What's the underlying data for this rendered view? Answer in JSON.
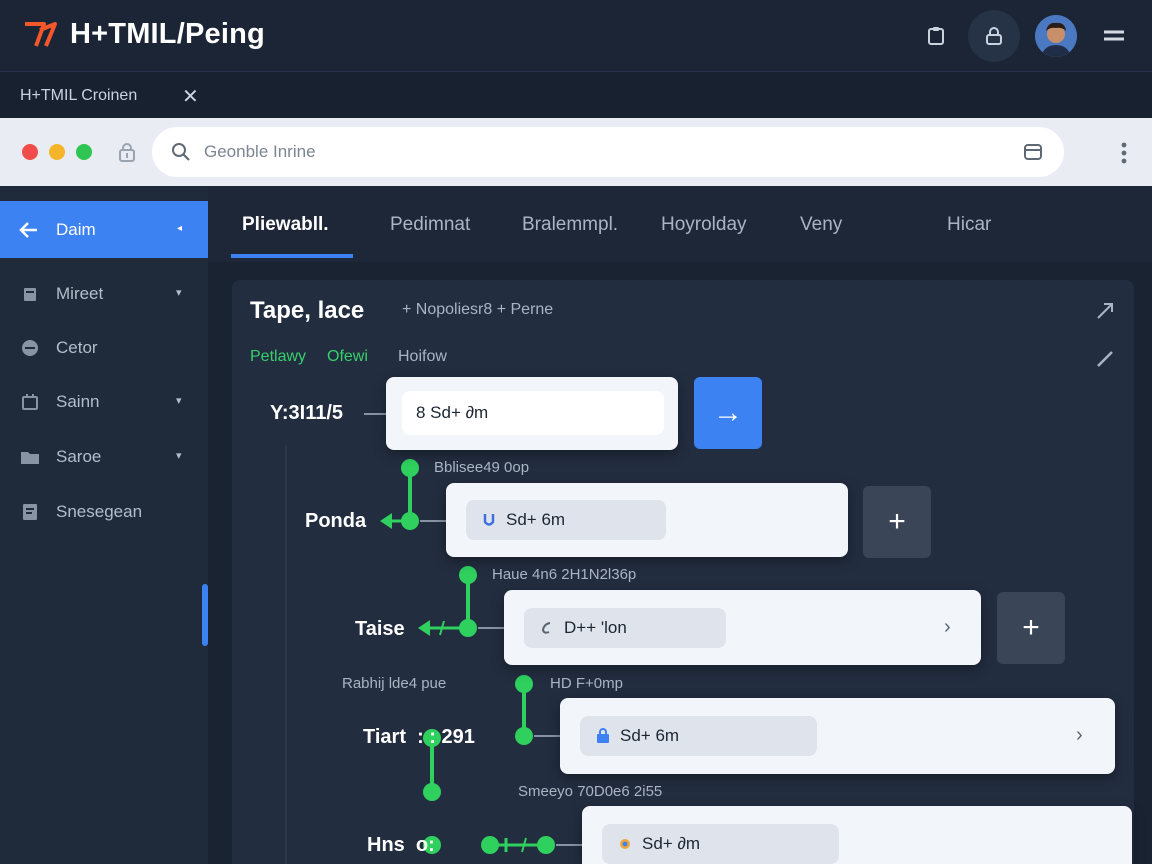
{
  "app": {
    "title": "H+TMIL/Peing"
  },
  "window_tab": {
    "label": "H+TMIL Croinen",
    "close": "✕"
  },
  "address_bar": {
    "placeholder": "Geonble Inrine"
  },
  "sidebar": {
    "items": [
      {
        "label": "Daim",
        "icon": "arrow-left-icon",
        "active": true
      },
      {
        "label": "Mireet",
        "icon": "folder-icon"
      },
      {
        "label": "Cetor",
        "icon": "settings-icon"
      },
      {
        "label": "Sainn",
        "icon": "calendar-icon"
      },
      {
        "label": "Saroe",
        "icon": "folder-icon"
      },
      {
        "label": "Snesegean",
        "icon": "document-icon"
      }
    ]
  },
  "nav_tabs": [
    "Pliewabll.",
    "Pedimnat",
    "Bralemmpl.",
    "Hoyrolday",
    "Veny",
    "Hicar"
  ],
  "panel": {
    "title": "Tape, lace",
    "add_label": "+  Nopoliesr8 + Perne",
    "filters": [
      "Petlawy",
      "Ofewi",
      "Hoifow"
    ]
  },
  "flow": {
    "nodes": [
      {
        "label": "Y:3I11/5",
        "caption": "",
        "pill_text": "8  Sd+ ∂m",
        "button": "→"
      },
      {
        "label": "Ponda",
        "caption": "Bblisee49 0op",
        "pill_text": "Sd+ 6m",
        "button": "+"
      },
      {
        "label": "Taise",
        "caption": "Haue 4n6 2H1N2l36p",
        "pill_text": "D++ 'lon",
        "button": "+"
      },
      {
        "label": "Tiart  : : 291",
        "caption": "HD F+0mp",
        "caption2": "Rabhij lde4 pue",
        "pill_text": "Sd+ 6m"
      },
      {
        "label": "Hns  o:",
        "caption": "Smeeyo  70D0e6 2i55",
        "pill_text": "Sd+ ∂m"
      }
    ]
  },
  "colors": {
    "accent": "#3d82f2",
    "flow_green": "#2fd05e",
    "sidebar_bg": "#1f2a3b"
  }
}
